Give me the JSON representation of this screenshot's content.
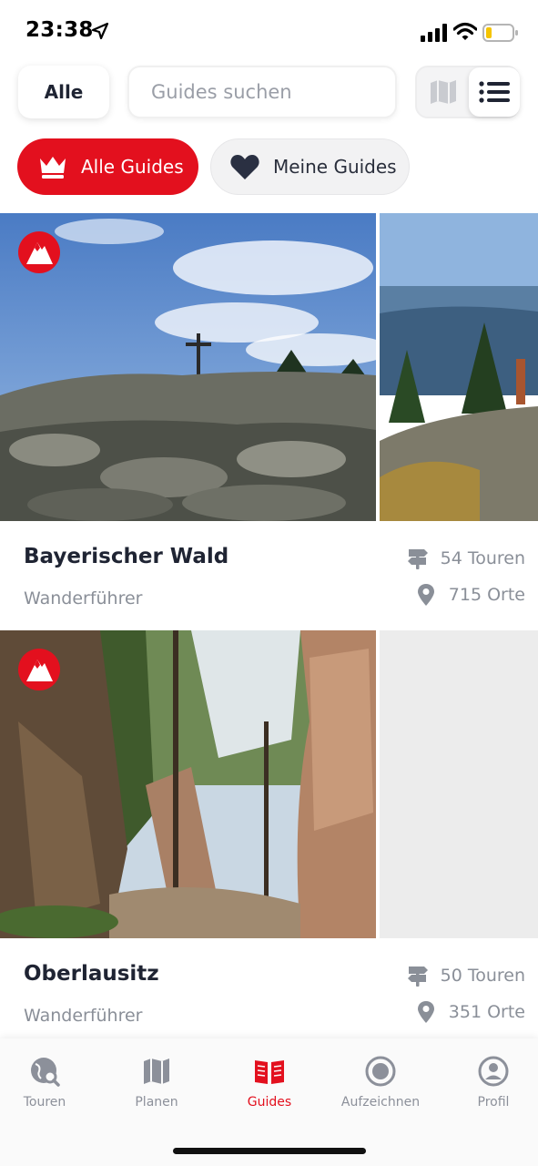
{
  "status_bar": {
    "time": "23:38"
  },
  "header": {
    "filter_label": "Alle",
    "search_placeholder": "Guides suchen",
    "view_toggle": {
      "map_icon": "map-icon",
      "list_icon": "list-icon",
      "selected": "list"
    }
  },
  "chips": {
    "all_guides": "Alle Guides",
    "my_guides": "Meine Guides",
    "active": "all_guides"
  },
  "guides": [
    {
      "title": "Bayerischer Wald",
      "subtitle": "Wanderführer",
      "tours": "54 Touren",
      "places": "715 Orte",
      "badge_icon": "mountain-badge-icon"
    },
    {
      "title": "Oberlausitz",
      "subtitle": "Wanderführer",
      "tours": "50 Touren",
      "places": "351 Orte",
      "badge_icon": "mountain-badge-icon"
    }
  ],
  "tabbar": {
    "items": [
      {
        "label": "Touren",
        "icon": "globe-search-icon"
      },
      {
        "label": "Planen",
        "icon": "map-icon"
      },
      {
        "label": "Guides",
        "icon": "book-icon",
        "active": true
      },
      {
        "label": "Aufzeichnen",
        "icon": "record-icon"
      },
      {
        "label": "Profil",
        "icon": "user-icon"
      }
    ]
  },
  "colors": {
    "accent": "#e3101e",
    "text": "#1f2433",
    "muted": "#8a8f98"
  }
}
